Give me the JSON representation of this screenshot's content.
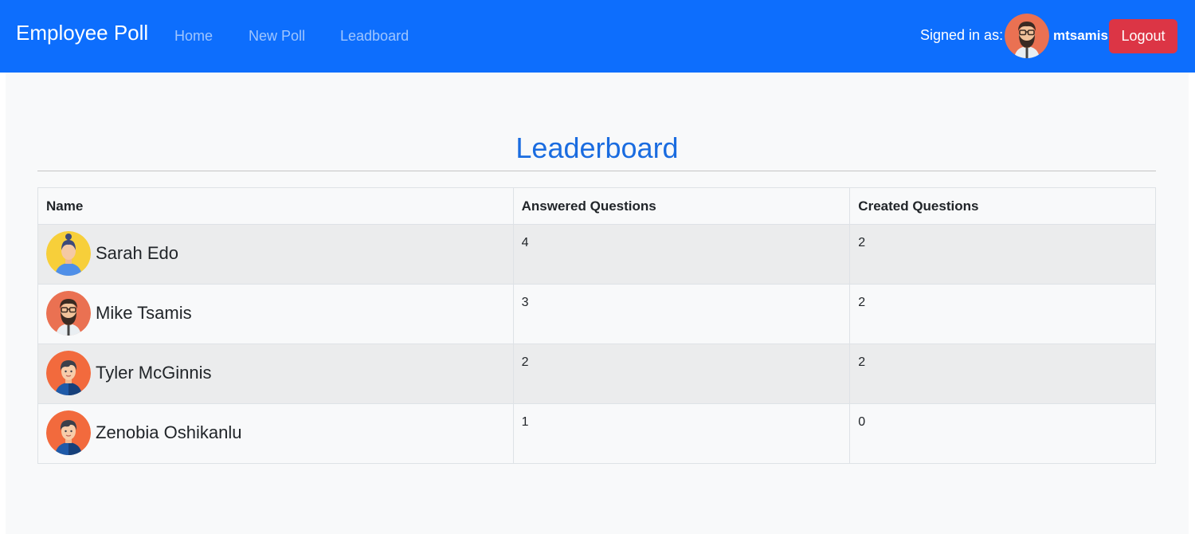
{
  "navbar": {
    "brand": "Employee Poll",
    "links": [
      "Home",
      "New Poll",
      "Leadboard"
    ],
    "signed_in_label": "Signed in as:",
    "username": "mtsamis",
    "logout_label": "Logout"
  },
  "main": {
    "title": "Leaderboard",
    "table": {
      "headers": [
        "Name",
        "Answered Questions",
        "Created Questions"
      ],
      "rows": [
        {
          "name": "Sarah Edo",
          "answered": "4",
          "created": "2",
          "avatar": "woman-avatar-icon"
        },
        {
          "name": "Mike Tsamis",
          "answered": "3",
          "created": "2",
          "avatar": "bearded-man-avatar-icon"
        },
        {
          "name": "Tyler McGinnis",
          "answered": "2",
          "created": "2",
          "avatar": "young-man-avatar-icon"
        },
        {
          "name": "Zenobia Oshikanlu",
          "answered": "1",
          "created": "0",
          "avatar": "young-man-avatar-icon"
        }
      ]
    }
  },
  "colors": {
    "navbar": "#0d6efd",
    "logout": "#dc3545",
    "title": "#1a6ce0",
    "row_stripe": "#ebeced",
    "page_background": "#f8f9fa"
  }
}
